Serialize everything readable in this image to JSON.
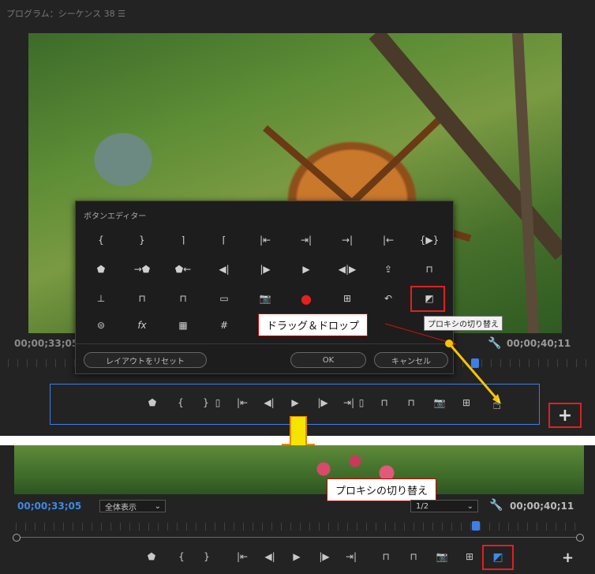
{
  "top_panel": {
    "title": "プログラム：シーケンス 38 ☰",
    "timecode_current": "00;00;33;05",
    "timecode_duration": "00;00;40;11",
    "add_button_label": "+"
  },
  "dialog": {
    "title": "ボタンエディター",
    "reset_layout_label": "レイアウトをリセット",
    "ok_label": "OK",
    "cancel_label": "キャンセル",
    "tooltip": "プロキシの切り替え"
  },
  "callouts": {
    "drag_drop": "ドラッグ＆ドロップ",
    "proxy_toggle": "プロキシの切り替え"
  },
  "bottom_panel": {
    "timecode_current": "00;00;33;05",
    "timecode_duration": "00;00;40;11",
    "fit_select": "全体表示",
    "resolution_select": "1/2",
    "add_button_label": "+"
  },
  "colors": {
    "accent_blue": "#3d7fe6",
    "highlight_red": "#e02020",
    "arrow_yellow": "#f5c400",
    "panel_bg": "#232323"
  }
}
